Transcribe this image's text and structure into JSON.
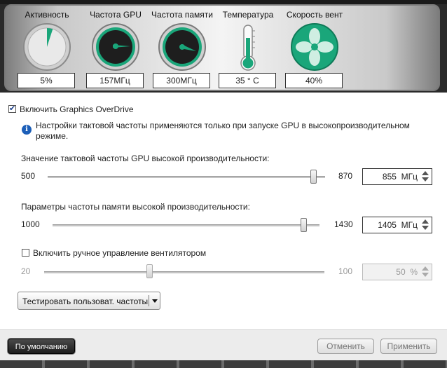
{
  "gauges": [
    {
      "title": "Активность",
      "value": "5%",
      "level_percent": 5
    },
    {
      "title": "Частота GPU",
      "value": "157МГц"
    },
    {
      "title": "Частота памяти",
      "value": "300МГц"
    },
    {
      "title": "Температура",
      "value": "35 ° C"
    },
    {
      "title": "Скорость вент",
      "value": "40%",
      "level_percent": 40
    }
  ],
  "colors": {
    "accent": "#1aa67a",
    "info": "#1d5fb8"
  },
  "overdrive": {
    "enable_label": "Включить Graphics OverDrive",
    "checked": true
  },
  "info_note": {
    "line1": "Настройки тактовой частоты применяются только при запуске GPU в высокопроизводительном",
    "line2": "режиме."
  },
  "gpu_clock": {
    "label": "Значение тактовой частоты GPU высокой производительности:",
    "min": "500",
    "max": "870",
    "value": "855",
    "unit": "МГц",
    "current": 855,
    "range": [
      500,
      870
    ]
  },
  "mem_clock": {
    "label": "Параметры частоты памяти высокой производительности:",
    "min": "1000",
    "max": "1430",
    "value": "1405",
    "unit": "МГц",
    "current": 1405,
    "range": [
      1000,
      1430
    ]
  },
  "fan": {
    "label": "Включить ручное управление вентилятором",
    "checked": false,
    "min": "20",
    "max": "100",
    "value": "50",
    "unit": "%",
    "current": 50,
    "range": [
      20,
      100
    ]
  },
  "test_button": {
    "label": "Тестировать пользоват. частоты"
  },
  "footer": {
    "default_label": "По умолчанию",
    "cancel_label": "Отменить",
    "apply_label": "Применить"
  }
}
